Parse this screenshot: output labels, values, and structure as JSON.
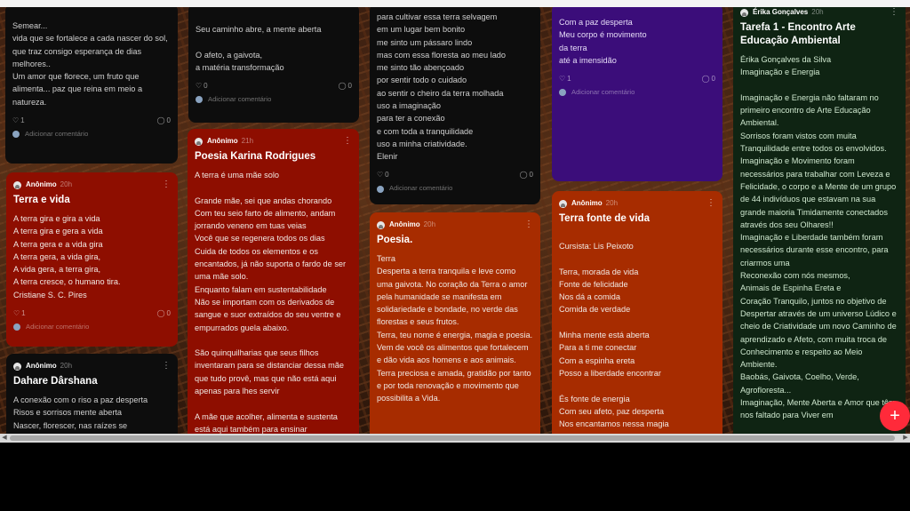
{
  "cards": [
    {
      "id": "c1",
      "author": "",
      "time": "",
      "title": "",
      "body": "Semear...\nvida que se fortalece a cada nascer do sol, que traz consigo esperança de dias melhores..\nUm amor que florece, um fruto que alimenta... paz que reina em meio a natureza.",
      "likes": "1",
      "comments": "0",
      "add_comment": "Adicionar comentário"
    },
    {
      "id": "c2",
      "author": "",
      "time": "",
      "title": "",
      "body": "Seu caminho abre, a mente aberta\n\nO afeto, a gaivota,\na matéria transformação",
      "likes": "0",
      "comments": "0",
      "add_comment": "Adicionar comentário"
    },
    {
      "id": "c3",
      "author": "",
      "time": "",
      "title": "",
      "body": "para cultivar essa terra selvagem\nem um lugar bem bonito\nme sinto um pássaro lindo\nmas com essa floresta ao meu lado\nme sinto tão abençoado\npor sentir todo o cuidado\nao sentir o cheiro da terra molhada\nuso a imaginação\npara ter a conexão\ne com toda a tranquilidade\nuso a minha criatividade.\nElenir",
      "likes": "0",
      "comments": "0",
      "add_comment": "Adicionar comentário"
    },
    {
      "id": "c4",
      "author": "",
      "time": "",
      "title": "",
      "body": "Com a paz desperta\nMeu corpo é movimento\nda terra\naté a imensidão",
      "likes": "1",
      "comments": "0",
      "add_comment": "Adicionar comentário"
    },
    {
      "id": "c5",
      "author": "Érika Gonçalves",
      "time": "20h",
      "title": "Tarefa 1 - Encontro Arte Educação Ambiental",
      "body": "Érika Gonçalves da Silva\nImaginação e Energia\n\nImaginação e Energia não faltaram no primeiro encontro de Arte Educação Ambiental.\nSorrisos foram vistos com muita Tranquilidade entre todos os envolvidos.\nImaginação e Movimento foram necessários para trabalhar com Leveza e Felicidade, o corpo e a Mente de um grupo de 44 indivíduos que estavam na sua grande maioria Timidamente conectados através dos seu Olhares!!\nImaginação e Liberdade também foram necessários durante esse encontro, para criarmos uma\nReconexão com nós mesmos,\nAnimais de Espinha Ereta e\nCoração Tranquilo, juntos no objetivo de Despertar através de um universo Lúdico e cheio de Criatividade um novo Caminho de aprendizado e Afeto, com muita troca de Conhecimento e respeito ao Meio Ambiente.\nBaobás, Gaivota, Coelho, Verde, Agrofloresta...\nImaginação, Mente Aberta e Amor que têm nos faltado para Viver em"
    },
    {
      "id": "c6",
      "author": "Anônimo",
      "time": "21h",
      "title": "Poesia Karina Rodrigues",
      "body": "A terra é uma mãe solo\n\nGrande mãe, sei que andas chorando\nCom teu seio farto de alimento, andam jorrando veneno em tuas veias\nVocê que se regenera todos os dias\nCuida de todos os elementos e os encantados, já não suporta o fardo de ser uma mãe solo.\nEnquanto falam em sustentabilidade\nNão se importam com os derivados de sangue e suor extraídos do seu ventre e empurrados guela abaixo.\n\nSão quinquilharias que seus filhos inventaram para se distanciar dessa mãe que tudo provê, mas que não está aqui apenas para lhes servir\n\nA mãe que acolher, alimenta e sustenta está aqui também para ensinar"
    },
    {
      "id": "c7",
      "author": "Anônimo",
      "time": "20h",
      "title": "Terra e vida",
      "body": "A terra gira e gira a vida\nA terra gira e gera a vida\nA terra gera e a vida gira\nA terra gera, a vida gira,\nA vida gera, a terra gira,\nA terra cresce, o humano tira.\nCristiane S. C. Pires",
      "likes": "1",
      "comments": "0",
      "add_comment": "Adicionar comentário"
    },
    {
      "id": "c8",
      "author": "Anônimo",
      "time": "20h",
      "title": "Dahare Dârshana",
      "body": "A conexão com o riso a paz desperta\nRisos e sorrisos mente aberta\nNascer, florescer, nas raízes se"
    },
    {
      "id": "c9",
      "author": "Anônimo",
      "time": "20h",
      "title": "Poesia.",
      "body": "Terra\nDesperta a terra tranquila e leve como uma gaivota. No coração da Terra o amor pela humanidade se manifesta em solidariedade e bondade, no verde das florestas e seus frutos.\nTerra, teu nome é energia, magia e poesia.\nVem de você os alimentos que fortalecem e dão vida aos homens e aos animais.\nTerra preciosa e amada, gratidão por tanto e por toda renovação e movimento que possibilita a Vida."
    },
    {
      "id": "c10",
      "author": "Anônimo",
      "time": "20h",
      "title": "Terra fonte de vida",
      "body": "Cursista: Lis Peixoto\n\nTerra, morada de vida\nFonte de felicidade\nNos dá a comida\nComida de verdade\n\nMinha mente está aberta\nPara a ti me conectar\nCom a espinha ereta\nPosso a liberdade encontrar\n\nÉs fonte de energia\nCom seu afeto, paz desperta\nNos encantamos nessa magia"
    }
  ],
  "fab_label": "+",
  "more_glyph": "⋮",
  "heart_glyph": "♡",
  "comment_glyph": "◯"
}
